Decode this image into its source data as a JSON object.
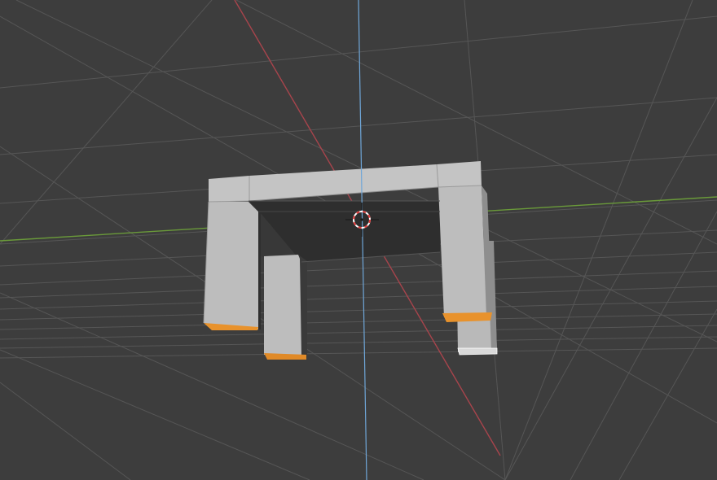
{
  "viewport": {
    "label": "3D Viewport",
    "background": "#3d3d3d",
    "grid_color": "#545454",
    "axis_x_color": "#b0444c",
    "axis_y_color": "#6a9a3a",
    "axis_z_color": "#6fa6d8"
  },
  "object": {
    "type": "table-mesh",
    "mode": "edit",
    "face_color": "#bcbcbc",
    "selected_face_color": "#e8922c",
    "underside_color": "#2f2f2f"
  },
  "cursor": {
    "type": "3d-cursor",
    "ring_color_a": "#ffffff",
    "ring_color_b": "#e23b3b"
  }
}
